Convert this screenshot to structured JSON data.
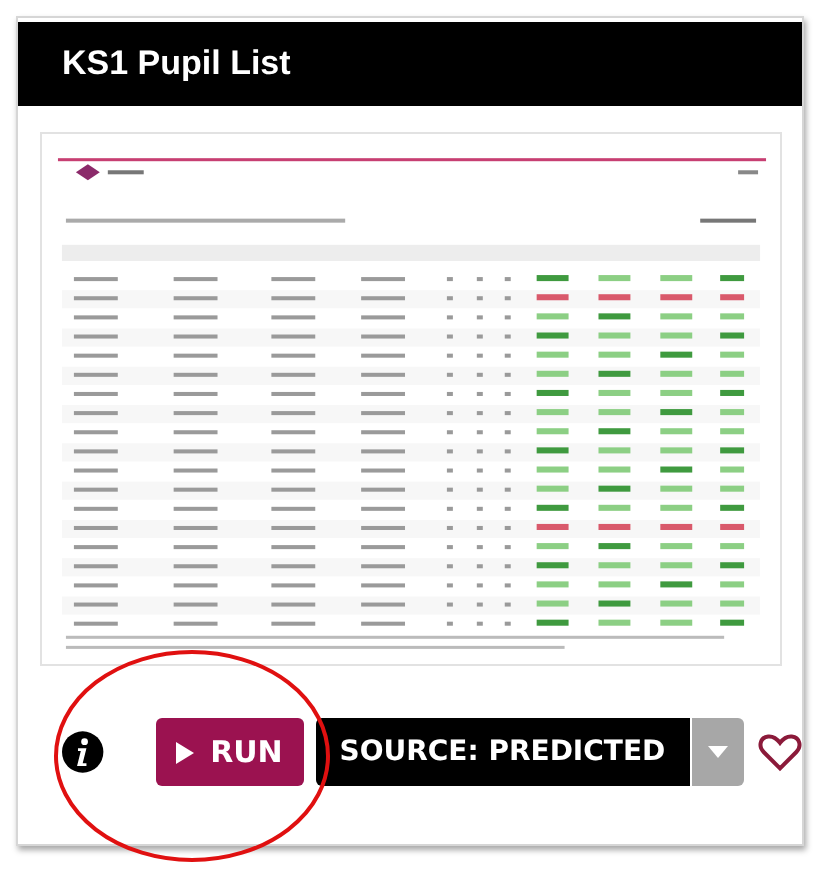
{
  "card": {
    "title": "KS1 Pupil List"
  },
  "actions": {
    "run_button": {
      "label": "RUN"
    },
    "source_button": {
      "label": "SOURCE: PREDICTED"
    },
    "favorite": {
      "selected": false
    }
  }
}
